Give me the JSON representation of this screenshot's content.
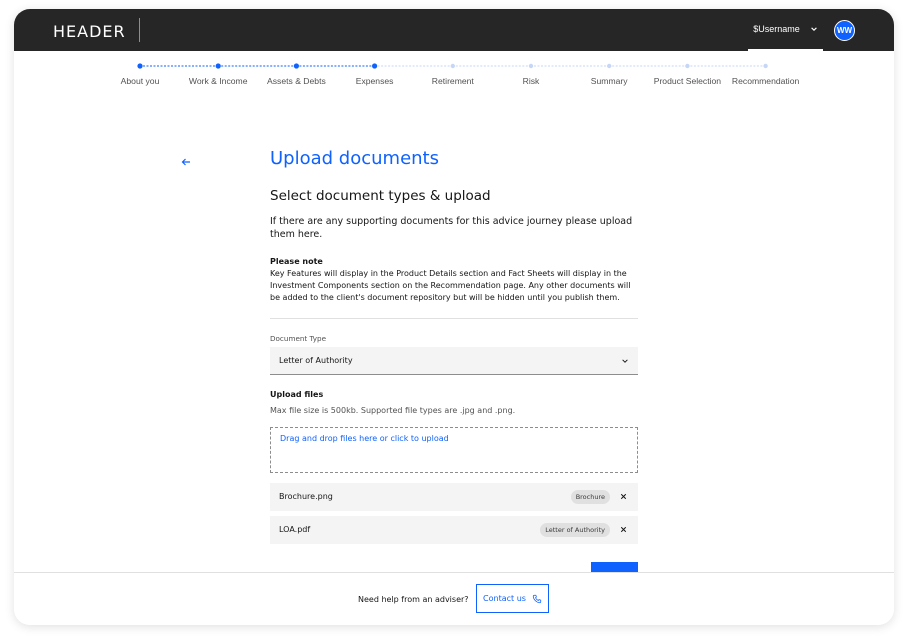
{
  "header": {
    "brand": "HEADER",
    "username": "$Username",
    "avatar_initials": "WW"
  },
  "progress": {
    "completed_count": 4,
    "steps": [
      {
        "label": "About you",
        "state": "complete"
      },
      {
        "label": "Work & Income",
        "state": "complete"
      },
      {
        "label": "Assets & Debts",
        "state": "complete"
      },
      {
        "label": "Expenses",
        "state": "current"
      },
      {
        "label": "Retirement",
        "state": "incomplete"
      },
      {
        "label": "Risk",
        "state": "incomplete"
      },
      {
        "label": "Summary",
        "state": "incomplete"
      },
      {
        "label": "Product Selection",
        "state": "incomplete"
      },
      {
        "label": "Recommendation",
        "state": "incomplete"
      }
    ]
  },
  "main": {
    "title": "Upload documents",
    "subtitle": "Select document types & upload",
    "intro": "If there are any supporting documents for this advice journey please upload them here.",
    "note_heading": "Please note",
    "note_body": "Key Features will display in the Product Details section and Fact Sheets will display in the Investment Components section on the Recommendation page. Any other documents will be added to the client's document repository but will be hidden until you publish them.",
    "document_type_label": "Document Type",
    "document_type_value": "Letter of Authority",
    "upload_heading": "Upload files",
    "upload_help": "Max file size is 500kb. Supported file types are .jpg and .png.",
    "dropzone_text": "Drag and drop files here or click to upload",
    "files": [
      {
        "name": "Brochure.png",
        "tag": "Brochure"
      },
      {
        "name": "LOA.pdf",
        "tag": "Letter of Authority"
      }
    ]
  },
  "footer": {
    "help_text": "Need help from an adviser?",
    "contact_label": "Contact us"
  },
  "colors": {
    "accent": "#0f62fe",
    "header_bg": "#262626",
    "field_bg": "#f4f4f4"
  },
  "icons": {
    "back": "arrow-left-icon",
    "dropdown": "chevron-down-icon",
    "remove": "close-icon",
    "contact": "phone-icon"
  }
}
